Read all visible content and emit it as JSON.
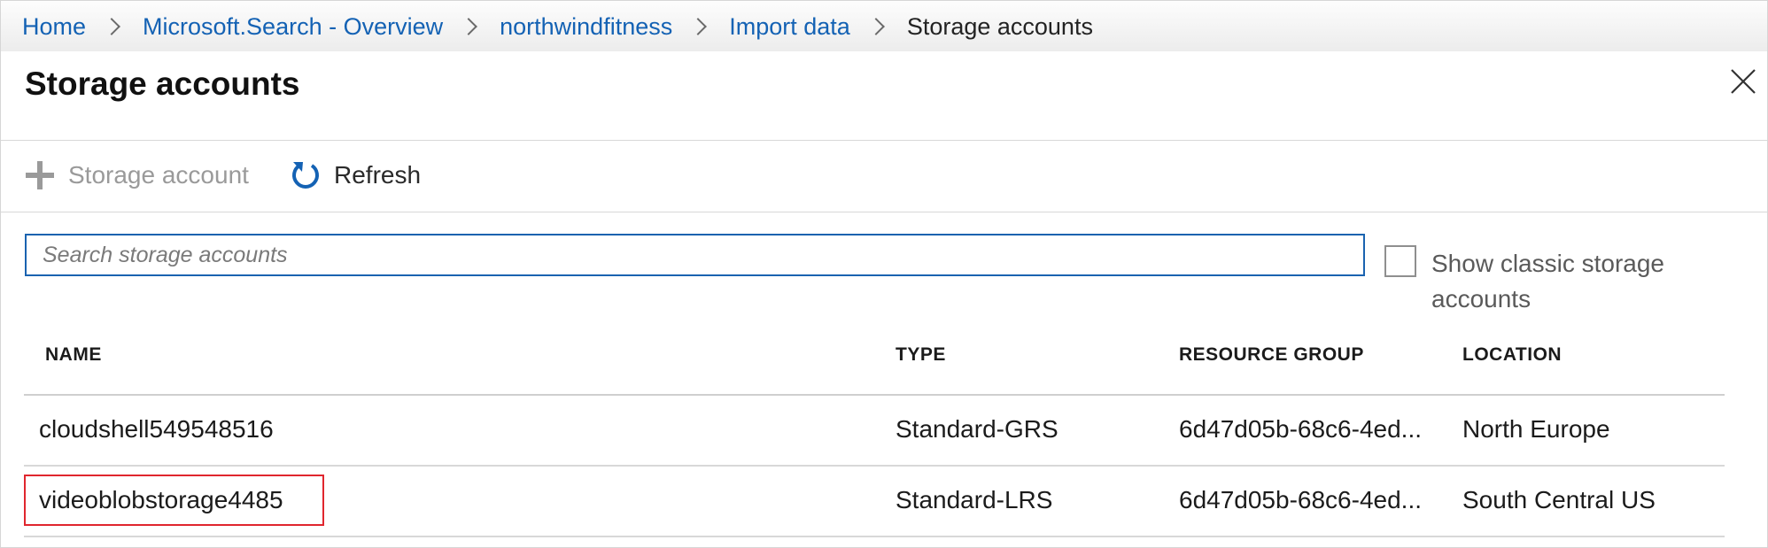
{
  "breadcrumb": {
    "items": [
      "Home",
      "Microsoft.Search - Overview",
      "northwindfitness",
      "Import data"
    ],
    "current": "Storage accounts"
  },
  "blade": {
    "title": "Storage accounts"
  },
  "toolbar": {
    "add_label": "Storage account",
    "refresh_label": "Refresh"
  },
  "search": {
    "placeholder": "Search storage accounts",
    "value": ""
  },
  "options": {
    "show_classic_label": "Show classic storage accounts",
    "show_classic_checked": false
  },
  "table": {
    "headers": {
      "name": "NAME",
      "type": "TYPE",
      "resource_group": "RESOURCE GROUP",
      "location": "LOCATION"
    },
    "rows": [
      {
        "name": "cloudshell549548516",
        "type": "Standard-GRS",
        "resource_group": "6d47d05b-68c6-4ed...",
        "location": "North Europe",
        "highlighted": false
      },
      {
        "name": "videoblobstorage4485",
        "type": "Standard-LRS",
        "resource_group": "6d47d05b-68c6-4ed...",
        "location": "South Central US",
        "highlighted": true
      }
    ]
  },
  "colors": {
    "link": "#1462b4",
    "accent": "#1a63b0",
    "highlight": "#e0262e",
    "disabled_text": "#9a9a9a"
  },
  "icons": {
    "add": "plus-icon",
    "refresh": "refresh-icon",
    "close": "close-icon",
    "separator": "chevron-right-icon"
  }
}
